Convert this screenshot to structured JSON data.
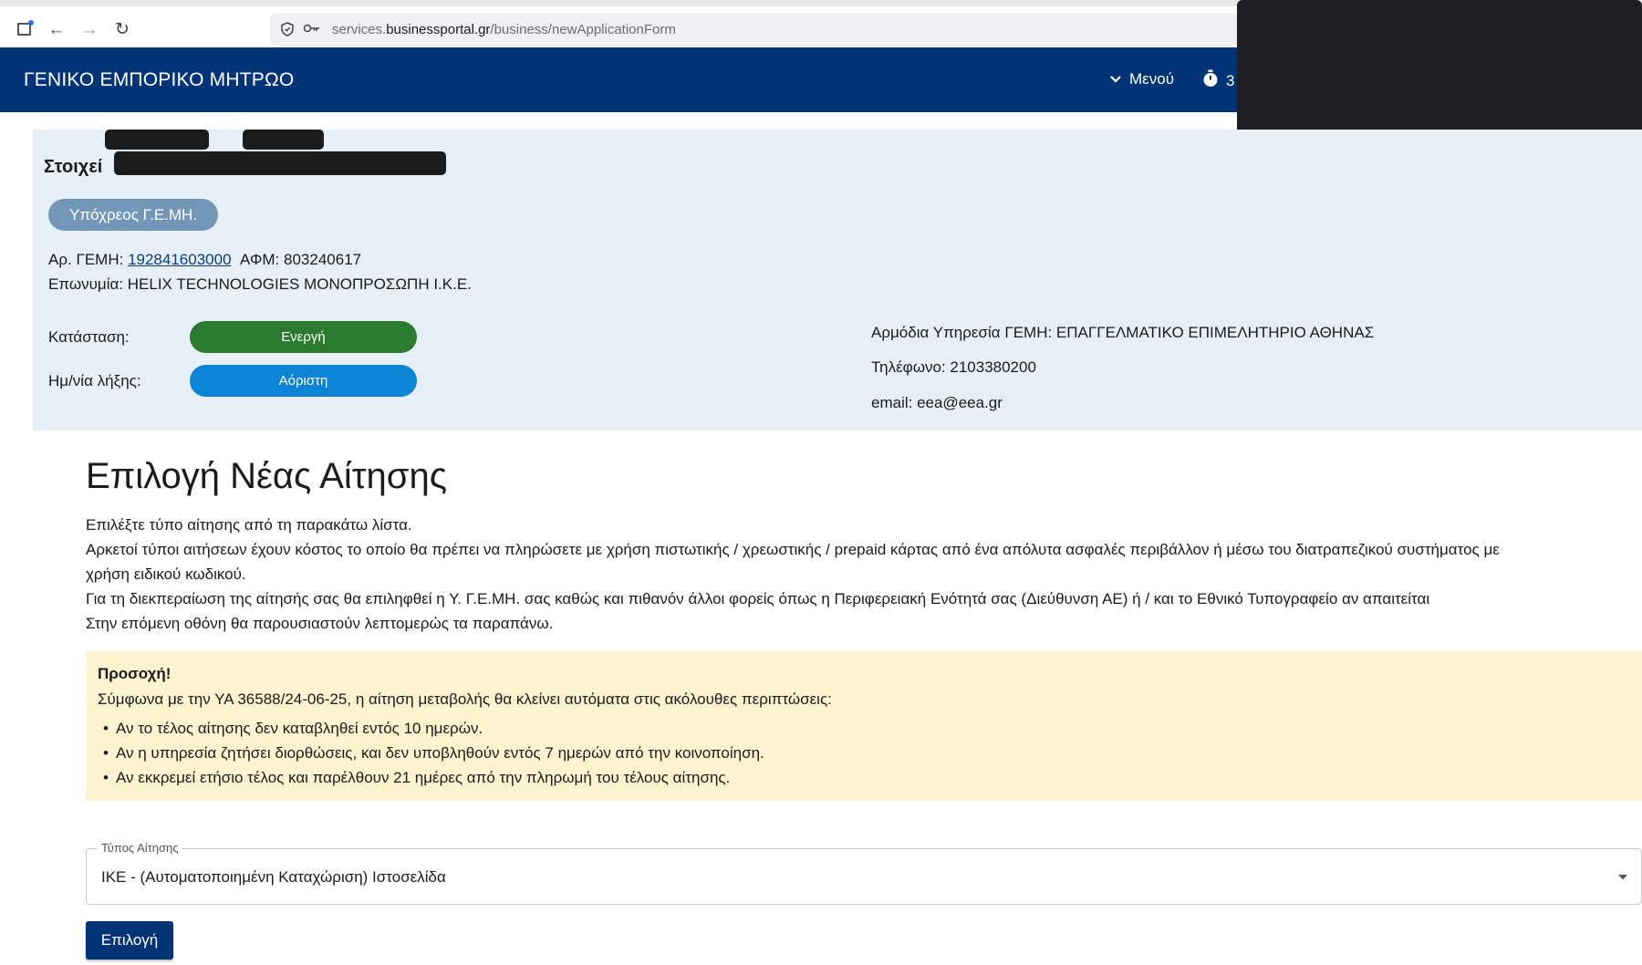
{
  "browser": {
    "url_prefix": "services.",
    "url_host": "businessportal.gr",
    "url_path": "/business/newApplicationForm"
  },
  "header": {
    "title": "ΓΕΝΙΚΟ ΕΜΠΟΡΙΚΟ ΜΗΤΡΩΟ",
    "menu_label": "Μενού",
    "timer_text": "3"
  },
  "company": {
    "section_title": "Στοιχεί",
    "badge": "Υπόχρεος Γ.Ε.ΜΗ.",
    "gemi_label": "Αρ. ΓΕΜΗ:",
    "gemi_number": "192841603000",
    "afm_label": "ΑΦΜ:",
    "afm_number": "803240617",
    "name_label": "Επωνυμία:",
    "name_value": "HELIX TECHNOLOGIES ΜΟΝΟΠΡΟΣΩΠΗ Ι.Κ.Ε.",
    "status_label": "Κατάσταση:",
    "status_value": "Ενεργή",
    "expiry_label": "Ημ/νία λήξης:",
    "expiry_value": "Αόριστη",
    "service_text": "Αρμόδια Υπηρεσία ΓΕΜΗ: ΕΠΑΓΓΕΛΜΑΤΙΚΟ ΕΠΙΜΕΛΗΤΗΡΙΟ ΑΘΗΝΑΣ",
    "phone_text": "Τηλέφωνο: 2103380200",
    "email_text": "email: eea@eea.gr"
  },
  "main": {
    "heading": "Επιλογή Νέας Αίτησης",
    "paragraphs": [
      "Επιλέξτε τύπο αίτησης από τη παρακάτω λίστα.",
      "Αρκετοί τύποι αιτήσεων έχουν κόστος το οποίο θα πρέπει να πληρώσετε με χρήση πιστωτικής / χρεωστικής / prepaid κάρτας από ένα απόλυτα ασφαλές περιβάλλον ή μέσω του διατραπεζικού συστήματος με",
      "χρήση ειδικού κωδικού.",
      "Για τη διεκπεραίωση της αίτησής σας θα επιληφθεί η Υ. Γ.Ε.ΜΗ. σας καθώς και πιθανόν άλλοι φορείς όπως η Περιφερειακή Ενότητά σας (Διεύθυνση ΑΕ) ή / και το Εθνικό Τυπογραφείο αν απαιτείται",
      "Στην επόμενη οθόνη θα παρουσιαστούν λεπτομερώς τα παραπάνω."
    ],
    "warning": {
      "title": "Προσοχή!",
      "text": "Σύμφωνα με την ΥΑ 36588/24-06-25, η αίτηση μεταβολής θα κλείνει αυτόματα στις ακόλουθες περιπτώσεις:",
      "items": [
        "Αν το τέλος αίτησης δεν καταβληθεί εντός 10 ημερών.",
        "Αν η υπηρεσία ζητήσει διορθώσεις, και δεν υποβληθούν εντός 7 ημερών από την κοινοποίηση.",
        "Αν εκκρεμεί ετήσιο τέλος και παρέλθουν 21 ημέρες από την πληρωμή του τέλους αίτησης."
      ]
    },
    "select": {
      "legend": "Τύπος Αίτησης",
      "value": "ΙΚΕ - (Αυτοματοποιημένη Καταχώριση) Ιστοσελίδα"
    },
    "submit_label": "Επιλογή"
  },
  "colors": {
    "header_bg": "#003476",
    "panel_bg": "#e7eff6",
    "status_active": "#2a7a2f",
    "expiry_indefinite": "#0b84d6",
    "warning_bg": "#fdf3cf"
  }
}
